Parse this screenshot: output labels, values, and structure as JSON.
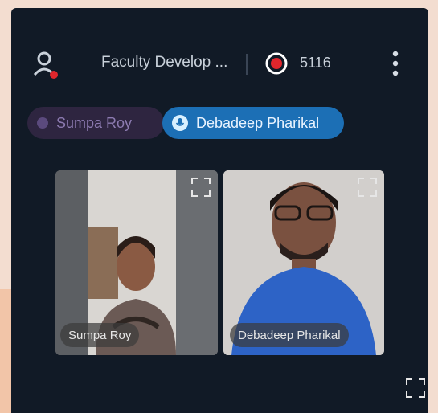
{
  "header": {
    "title": "Faculty Develop ...",
    "timer": "5116",
    "record_color": "#e0262c"
  },
  "speakers": [
    {
      "name": "Sumpa Roy",
      "active": false
    },
    {
      "name": "Debadeep Pharikal",
      "active": true
    }
  ],
  "tiles": [
    {
      "name": "Sumpa Roy"
    },
    {
      "name": "Debadeep Pharikal"
    }
  ],
  "icons": {
    "participants": "person-icon",
    "record": "record-icon",
    "more": "more-vertical-icon",
    "expand": "expand-icon",
    "fullscreen": "fullscreen-icon",
    "mic": "mic-icon"
  },
  "colors": {
    "background": "#111a26",
    "active_pill": "#1c6fb5",
    "inactive_pill": "#2e2540"
  }
}
